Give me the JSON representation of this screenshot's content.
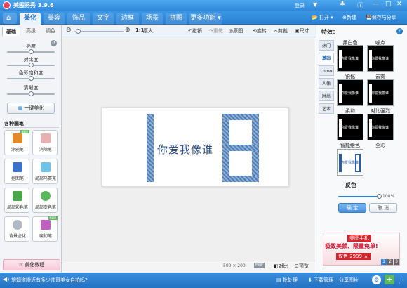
{
  "app": {
    "title": "美图秀秀 3.9.6",
    "login": "登录"
  },
  "nav": {
    "tabs": [
      "美化",
      "美容",
      "饰品",
      "文字",
      "边框",
      "场景",
      "拼图",
      "更多功能"
    ],
    "active": "美化",
    "open_label": "打开",
    "new_label": "新建",
    "save_label": "保存与分享"
  },
  "toolbar": {
    "zoom_ratio": "1:1",
    "original_size": "原大",
    "undo": "撤销",
    "redo": "重做",
    "original": "原图",
    "rotate": "旋转",
    "crop": "剪裁",
    "resize": "尺寸"
  },
  "left_panel": {
    "tabs": [
      "基础",
      "高级",
      "调色"
    ],
    "sliders": [
      {
        "label": "亮度",
        "value": 0.5
      },
      {
        "label": "对比度",
        "value": 0.5
      },
      {
        "label": "色彩饱和度",
        "value": 0.5
      },
      {
        "label": "清晰度",
        "value": 0.5
      }
    ],
    "one_click": "一键美化",
    "pens_title": "各种画笔",
    "pens": [
      {
        "label": "涂鸦笔",
        "badge": "NEW",
        "color": "#e38a2a"
      },
      {
        "label": "消除笔",
        "badge": "",
        "color": "#e8b0b0"
      },
      {
        "label": "抠图笔",
        "badge": "",
        "color": "#3a72c8"
      },
      {
        "label": "局部马赛克",
        "badge": "",
        "color": "#6fc3e8"
      },
      {
        "label": "局部彩色笔",
        "badge": "",
        "color": "#4aa84a"
      },
      {
        "label": "局部变色笔",
        "badge": "",
        "color": "#5cb85c"
      },
      {
        "label": "背景虚化",
        "badge": "",
        "color": "#b0b8c2"
      },
      {
        "label": "魔幻笔",
        "badge": "NEW",
        "color": "#c060c0"
      }
    ],
    "tutorial": "美化教程"
  },
  "canvas": {
    "image_text": "你爱我像谁",
    "status_size": "500 × 200",
    "status_exif": "EXIF",
    "compare": "对比",
    "preview": "预览"
  },
  "right_panel": {
    "title": "特效：",
    "side_tabs": [
      "热门",
      "基础",
      "Lomo",
      "人像",
      "时尚",
      "艺术"
    ],
    "active_tab": "基础",
    "effects": [
      {
        "label": "黑白色"
      },
      {
        "label": "噪点"
      },
      {
        "label": "锐化"
      },
      {
        "label": "去雾"
      },
      {
        "label": "柔和"
      },
      {
        "label": "对比强烈"
      },
      {
        "label": "智能绘色"
      },
      {
        "label": "全彩"
      }
    ],
    "thumb_text": "你爱我像谁",
    "selected_effect": "反色",
    "opacity_value": "100%",
    "opacity_fraction": 1.0,
    "confirm": "确 定",
    "cancel": "取 消",
    "ad": {
      "brand": "美图手机",
      "headline": "极致美颜、限量免单!",
      "price": "仅售 2999 元",
      "pages": [
        "1",
        "2",
        "3"
      ]
    }
  },
  "bottom": {
    "tip": "想知道附近有多少帅哥美女自拍吗?",
    "batch": "批处理",
    "download": "下载管理",
    "share": "分享图片"
  },
  "colors": {
    "accent": "#2a7fd3",
    "active_tab": "#eaf3fc",
    "confirm": "#5aa0e6",
    "ad_red": "#d8232a"
  }
}
